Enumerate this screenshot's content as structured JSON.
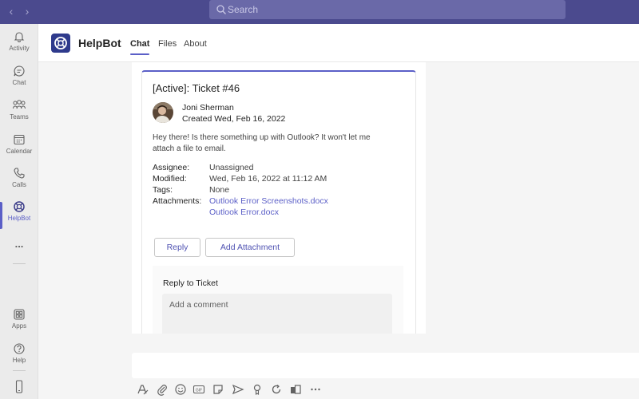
{
  "top_bar": {
    "search_placeholder": "Search"
  },
  "rail": {
    "items": [
      {
        "label": "Activity",
        "icon": "bell-icon"
      },
      {
        "label": "Chat",
        "icon": "chat-icon"
      },
      {
        "label": "Teams",
        "icon": "teams-icon"
      },
      {
        "label": "Calendar",
        "icon": "calendar-icon"
      },
      {
        "label": "Calls",
        "icon": "phone-icon"
      },
      {
        "label": "HelpBot",
        "icon": "lifebuoy-icon"
      }
    ],
    "more": "...",
    "bottom_items": [
      {
        "label": "Apps",
        "icon": "apps-icon"
      },
      {
        "label": "Help",
        "icon": "help-icon"
      }
    ]
  },
  "app_header": {
    "name": "HelpBot",
    "tabs": [
      "Chat",
      "Files",
      "About"
    ],
    "active_tab": "Chat"
  },
  "ticket_card": {
    "title": "[Active]: Ticket #46",
    "user_name": "Joni Sherman",
    "created": "Created Wed, Feb 16, 2022",
    "message": "Hey there! Is there something up with Outlook? It won't let me attach a file to email.",
    "fields": {
      "assignee_label": "Assignee:",
      "assignee_value": "Unassigned",
      "modified_label": "Modified:",
      "modified_value": "Wed, Feb 16, 2022 at 11:12 AM",
      "tags_label": "Tags:",
      "tags_value": "None",
      "attachments_label": "Attachments:",
      "attachments": [
        "Outlook Error Screenshots.docx",
        "Outlook Error.docx"
      ]
    },
    "buttons": {
      "reply": "Reply",
      "add_attachment": "Add Attachment"
    },
    "reply_section": {
      "title": "Reply to Ticket",
      "comment_placeholder": "Add a comment"
    }
  },
  "colors": {
    "brand": "#4b4a8e",
    "accent": "#5b5fc7",
    "app_logo": "#2e3a8c"
  }
}
